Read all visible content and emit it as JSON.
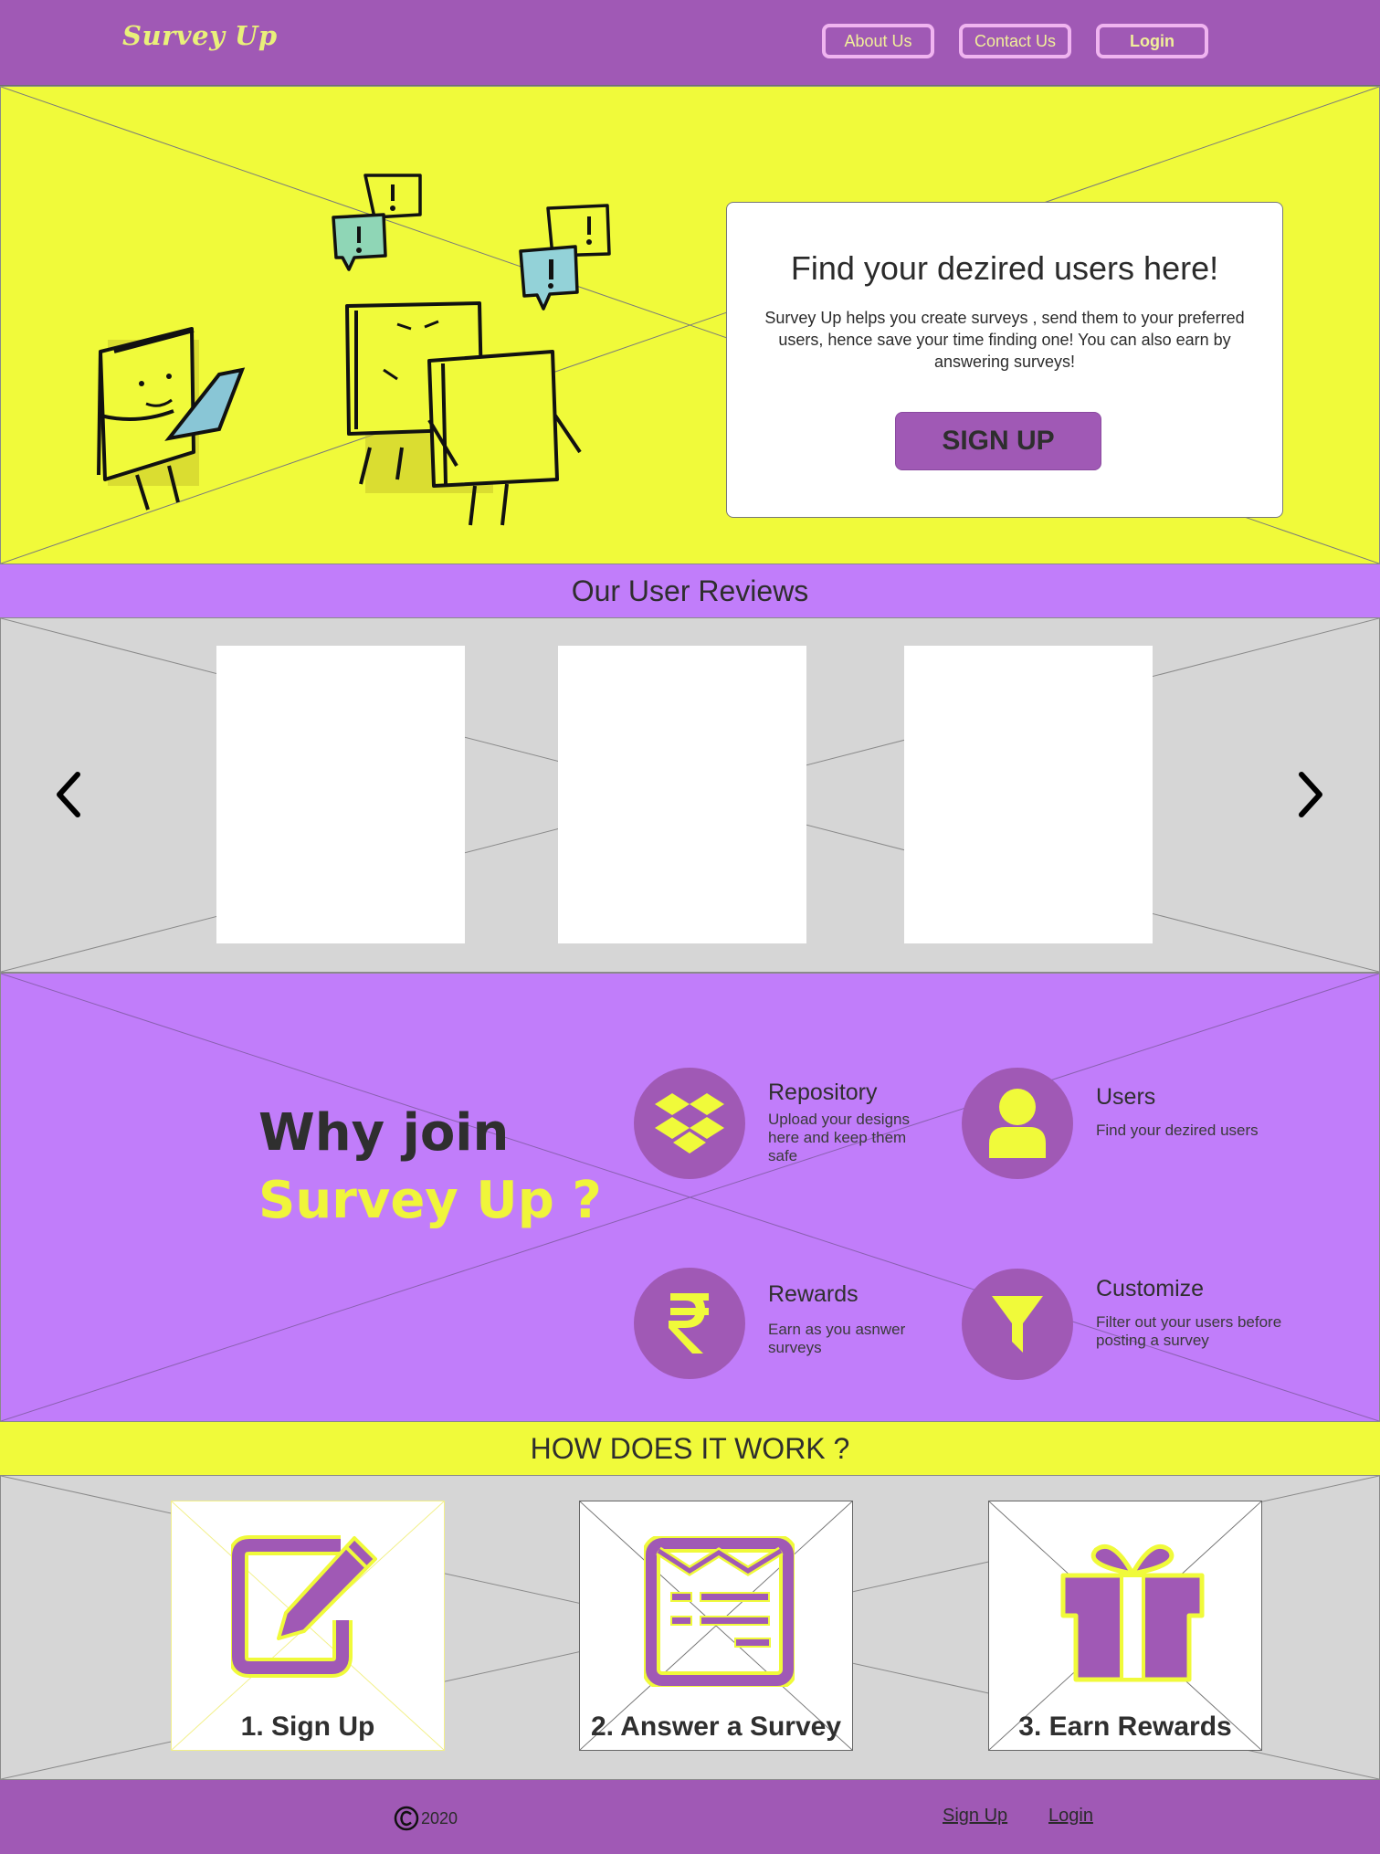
{
  "header": {
    "logo": "Survey Up",
    "nav": {
      "about": "About Us",
      "contact": "Contact Us",
      "login": "Login"
    }
  },
  "hero": {
    "title": "Find your dezired users here!",
    "text": "Survey Up helps you create surveys , send them to your preferred users, hence save your time finding one! You can also earn by answering surveys!",
    "signup": "SIGN UP"
  },
  "reviews": {
    "heading": "Our User Reviews",
    "prev_icon": "chevron-left-icon",
    "next_icon": "chevron-right-icon"
  },
  "why": {
    "line1": "Why join",
    "line2": "Survey Up ?",
    "features": [
      {
        "title": "Repository",
        "desc": "Upload your designs here and keep them safe",
        "icon": "dropbox-icon"
      },
      {
        "title": "Users",
        "desc": "Find your dezired users",
        "icon": "user-icon"
      },
      {
        "title": "Rewards",
        "desc": "Earn as you asnwer surveys",
        "icon": "rupee-icon"
      },
      {
        "title": "Customize",
        "desc": "Filter out your users before posting a survey",
        "icon": "filter-icon"
      }
    ]
  },
  "how": {
    "heading": "HOW DOES IT WORK ?",
    "steps": [
      {
        "label": "1. Sign Up",
        "icon": "edit-icon"
      },
      {
        "label": "2. Answer a Survey",
        "icon": "survey-mail-icon"
      },
      {
        "label": "3. Earn Rewards",
        "icon": "gift-icon"
      }
    ]
  },
  "footer": {
    "year": "2020",
    "signup": "Sign Up",
    "login": "Login"
  },
  "colors": {
    "purple": "#a059b5",
    "lilac": "#c17dfa",
    "yellow": "#f0fa3a",
    "gray": "#d6d6d6"
  }
}
